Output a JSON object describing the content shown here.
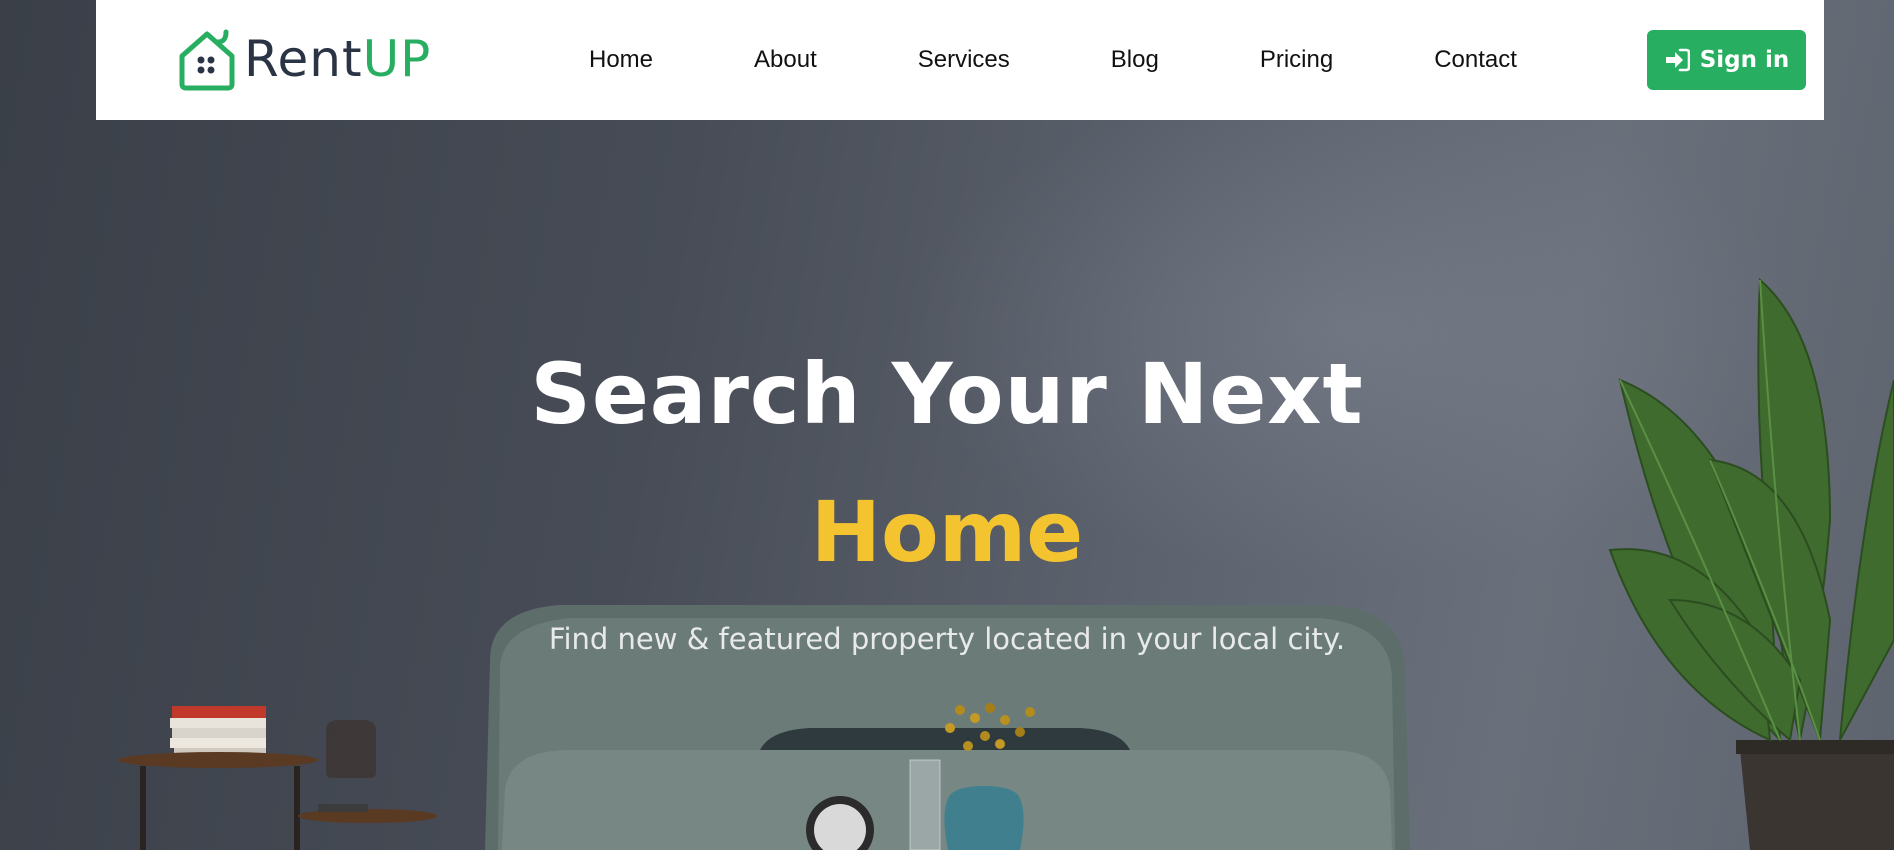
{
  "brand": {
    "name_part1": "Rent",
    "name_part2": "UP",
    "primary_color": "#27ae60",
    "dark_color": "#2b3445",
    "accent_color": "#f4c430"
  },
  "nav": {
    "items": [
      {
        "label": "Home"
      },
      {
        "label": "About"
      },
      {
        "label": "Services"
      },
      {
        "label": "Blog"
      },
      {
        "label": "Pricing"
      },
      {
        "label": "Contact"
      }
    ],
    "signin_label": "Sign in",
    "signin_icon": "sign-in-icon"
  },
  "hero": {
    "title_line1": "Search Your Next",
    "title_line2": "Home",
    "subtitle": "Find new & featured property located in your local city."
  }
}
